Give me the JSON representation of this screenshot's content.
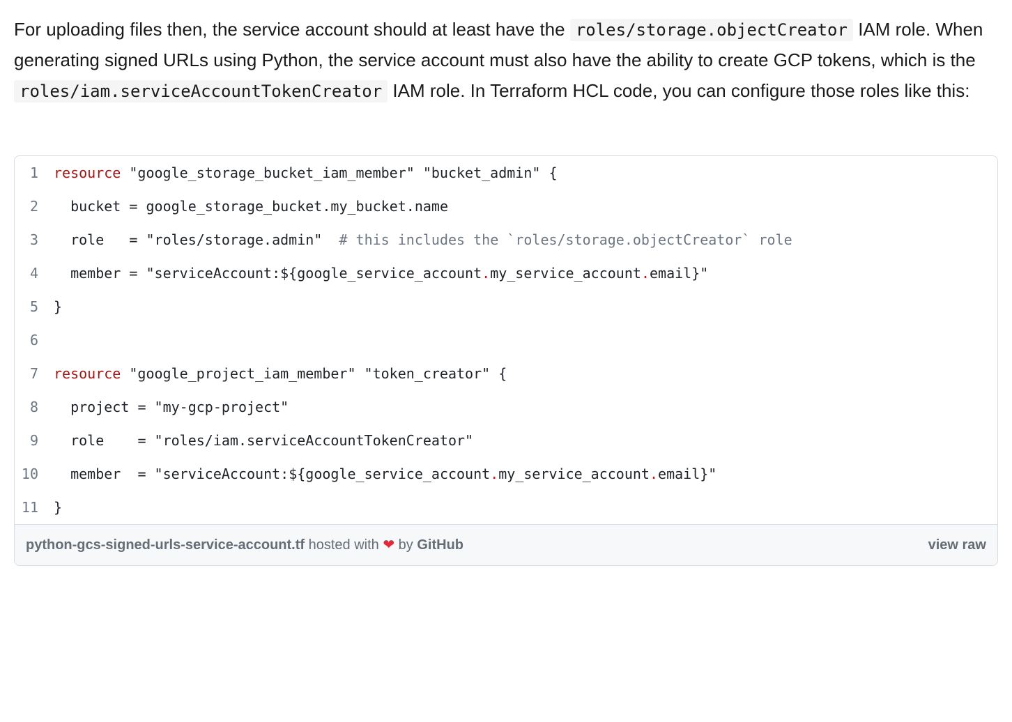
{
  "prose": {
    "paragraph_parts": [
      {
        "t": "text",
        "v": "For uploading files then, the service account should at least have the "
      },
      {
        "t": "code",
        "v": "roles/storage.objectCreator"
      },
      {
        "t": "text",
        "v": " IAM role. When generating signed URLs using Python, the service account must also have the ability to create GCP tokens, which is the "
      },
      {
        "t": "code",
        "v": "roles/iam.serviceAccountTokenCreator"
      },
      {
        "t": "text",
        "v": " IAM role. In Terraform HCL code, you can configure those roles like this:"
      }
    ]
  },
  "gist": {
    "lines": [
      {
        "n": 1,
        "tokens": [
          {
            "c": "kw",
            "v": "resource"
          },
          {
            "c": "",
            "v": " "
          },
          {
            "c": "str",
            "v": "\"google_storage_bucket_iam_member\""
          },
          {
            "c": "",
            "v": " "
          },
          {
            "c": "str",
            "v": "\"bucket_admin\""
          },
          {
            "c": "",
            "v": " "
          },
          {
            "c": "punct",
            "v": "{"
          }
        ]
      },
      {
        "n": 2,
        "tokens": [
          {
            "c": "",
            "v": "  "
          },
          {
            "c": "attr",
            "v": "bucket"
          },
          {
            "c": "",
            "v": " "
          },
          {
            "c": "punct",
            "v": "="
          },
          {
            "c": "",
            "v": " "
          },
          {
            "c": "attr",
            "v": "google_storage_bucket"
          },
          {
            "c": "dot",
            "v": "."
          },
          {
            "c": "attr",
            "v": "my_bucket"
          },
          {
            "c": "dot",
            "v": "."
          },
          {
            "c": "attr",
            "v": "name"
          }
        ]
      },
      {
        "n": 3,
        "tokens": [
          {
            "c": "",
            "v": "  "
          },
          {
            "c": "attr",
            "v": "role"
          },
          {
            "c": "",
            "v": "   "
          },
          {
            "c": "punct",
            "v": "="
          },
          {
            "c": "",
            "v": " "
          },
          {
            "c": "str",
            "v": "\"roles/storage.admin\""
          },
          {
            "c": "",
            "v": "  "
          },
          {
            "c": "comment",
            "v": "# this includes the `roles/storage.objectCreator` role"
          }
        ]
      },
      {
        "n": 4,
        "tokens": [
          {
            "c": "",
            "v": "  "
          },
          {
            "c": "attr",
            "v": "member"
          },
          {
            "c": "",
            "v": " "
          },
          {
            "c": "punct",
            "v": "="
          },
          {
            "c": "",
            "v": " "
          },
          {
            "c": "str",
            "v": "\"serviceAccount:"
          },
          {
            "c": "interp-open",
            "v": "${"
          },
          {
            "c": "attr",
            "v": "google_service_account"
          },
          {
            "c": "interp-dot",
            "v": "."
          },
          {
            "c": "attr",
            "v": "my_service_account"
          },
          {
            "c": "interp-dot",
            "v": "."
          },
          {
            "c": "attr",
            "v": "email"
          },
          {
            "c": "interp-close",
            "v": "}"
          },
          {
            "c": "str",
            "v": "\""
          }
        ]
      },
      {
        "n": 5,
        "tokens": [
          {
            "c": "punct",
            "v": "}"
          }
        ]
      },
      {
        "n": 6,
        "tokens": [
          {
            "c": "",
            "v": ""
          }
        ]
      },
      {
        "n": 7,
        "tokens": [
          {
            "c": "kw",
            "v": "resource"
          },
          {
            "c": "",
            "v": " "
          },
          {
            "c": "str",
            "v": "\"google_project_iam_member\""
          },
          {
            "c": "",
            "v": " "
          },
          {
            "c": "str",
            "v": "\"token_creator\""
          },
          {
            "c": "",
            "v": " "
          },
          {
            "c": "punct",
            "v": "{"
          }
        ]
      },
      {
        "n": 8,
        "tokens": [
          {
            "c": "",
            "v": "  "
          },
          {
            "c": "attr",
            "v": "project"
          },
          {
            "c": "",
            "v": " "
          },
          {
            "c": "punct",
            "v": "="
          },
          {
            "c": "",
            "v": " "
          },
          {
            "c": "str",
            "v": "\"my-gcp-project\""
          }
        ]
      },
      {
        "n": 9,
        "tokens": [
          {
            "c": "",
            "v": "  "
          },
          {
            "c": "attr",
            "v": "role"
          },
          {
            "c": "",
            "v": "    "
          },
          {
            "c": "punct",
            "v": "="
          },
          {
            "c": "",
            "v": " "
          },
          {
            "c": "str",
            "v": "\"roles/iam.serviceAccountTokenCreator\""
          }
        ]
      },
      {
        "n": 10,
        "tokens": [
          {
            "c": "",
            "v": "  "
          },
          {
            "c": "attr",
            "v": "member"
          },
          {
            "c": "",
            "v": "  "
          },
          {
            "c": "punct",
            "v": "="
          },
          {
            "c": "",
            "v": " "
          },
          {
            "c": "str",
            "v": "\"serviceAccount:"
          },
          {
            "c": "interp-open",
            "v": "${"
          },
          {
            "c": "attr",
            "v": "google_service_account"
          },
          {
            "c": "interp-dot",
            "v": "."
          },
          {
            "c": "attr",
            "v": "my_service_account"
          },
          {
            "c": "interp-dot",
            "v": "."
          },
          {
            "c": "attr",
            "v": "email"
          },
          {
            "c": "interp-close",
            "v": "}"
          },
          {
            "c": "str",
            "v": "\""
          }
        ]
      },
      {
        "n": 11,
        "tokens": [
          {
            "c": "punct",
            "v": "}"
          }
        ]
      }
    ],
    "footer": {
      "filename": "python-gcs-signed-urls-service-account.tf",
      "hosted_with": " hosted with ",
      "heart": "❤",
      "by": " by ",
      "github": "GitHub",
      "view_raw": "view raw"
    }
  }
}
